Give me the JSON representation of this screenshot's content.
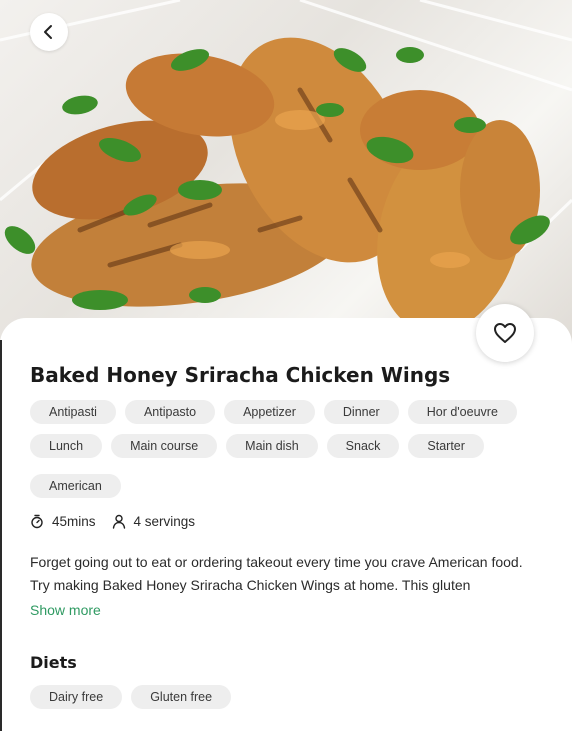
{
  "header": {
    "back_icon": "chevron-left-icon",
    "favorite_icon": "heart-outline-icon",
    "hero_image": "baked-honey-sriracha-chicken-wings-photo"
  },
  "recipe": {
    "title": "Baked Honey Sriracha Chicken Wings",
    "dish_types": [
      "Antipasti",
      "Antipasto",
      "Appetizer",
      "Dinner",
      "Hor d'oeuvre",
      "Lunch",
      "Main course",
      "Main dish",
      "Snack",
      "Starter"
    ],
    "cuisines": [
      "American"
    ],
    "time": "45mins",
    "servings": "4 servings",
    "description": "Forget going out to eat or ordering takeout every time you crave American food. Try making Baked Honey Sriracha Chicken Wings at home. This gluten",
    "show_more_label": "Show more"
  },
  "diets": {
    "title": "Diets",
    "items": [
      "Dairy free",
      "Gluten free"
    ]
  },
  "colors": {
    "accent": "#2f9a62",
    "chip_bg": "#eeeeee"
  }
}
